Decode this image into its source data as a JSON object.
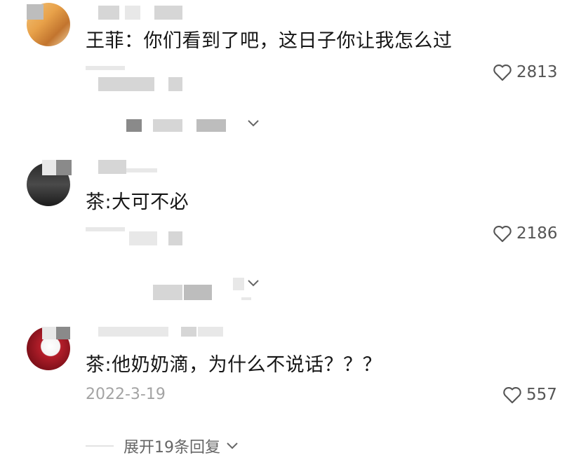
{
  "comments": [
    {
      "text": "王菲：你们看到了吧，这日子你让我怎么过",
      "likes": "2813"
    },
    {
      "text": "茶:大可不必",
      "likes": "2186"
    },
    {
      "text": "茶:他奶奶滴，为什么不说话？？？",
      "date": "2022-3-19",
      "likes": "557",
      "expand_label": "展开19条回复"
    }
  ],
  "icons": {
    "like": "heart-outline-icon",
    "expand": "chevron-down-icon"
  },
  "colors": {
    "text": "#161616",
    "meta": "#a3a3a3",
    "like": "#555555"
  }
}
